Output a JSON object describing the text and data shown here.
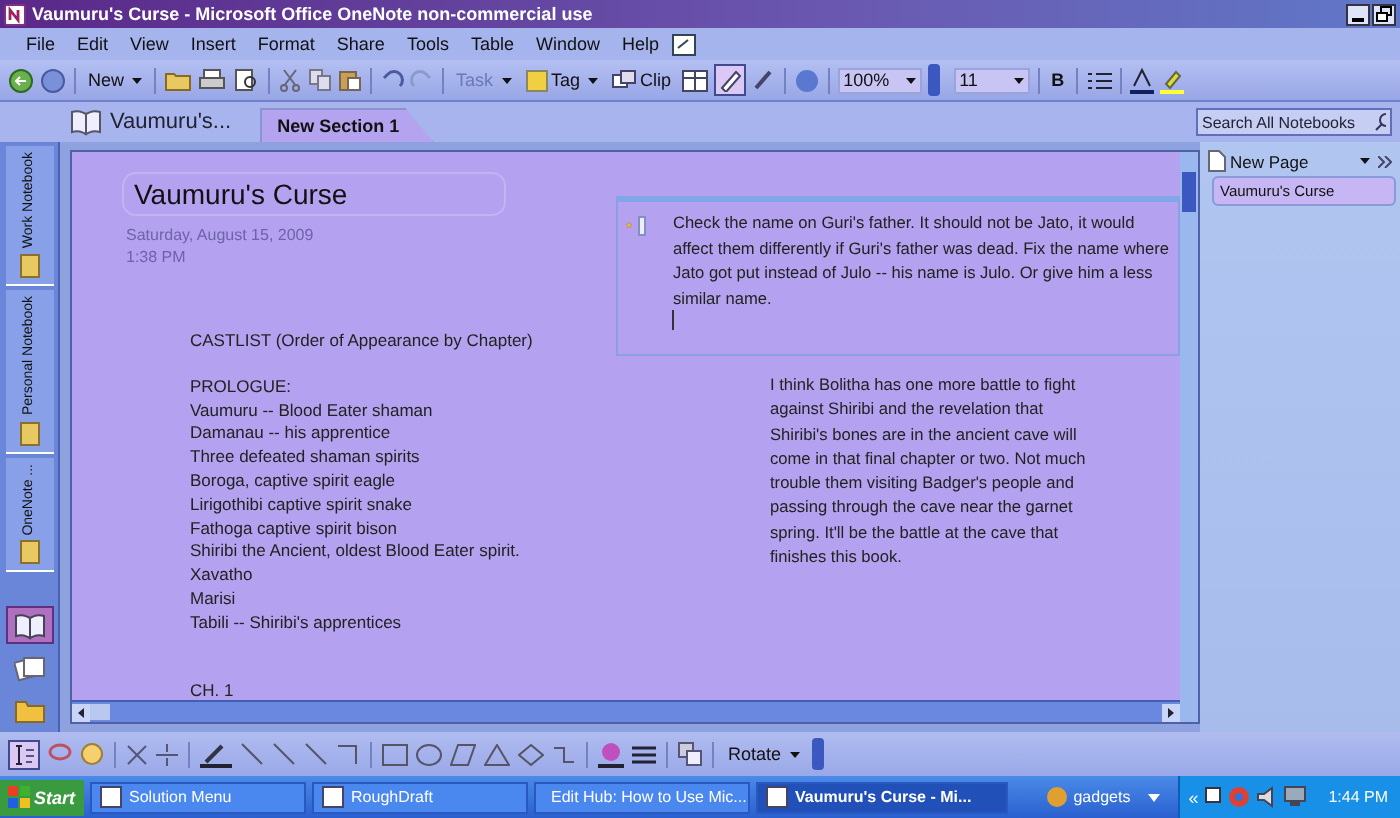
{
  "window": {
    "title": "Vaumuru's Curse - Microsoft Office OneNote non-commercial use"
  },
  "menu": [
    "File",
    "Edit",
    "View",
    "Insert",
    "Format",
    "Share",
    "Tools",
    "Table",
    "Window",
    "Help"
  ],
  "toolbar": {
    "new": "New",
    "task": {
      "label": "Task",
      "disabled": true
    },
    "tag": "Tag",
    "clip": "Clip",
    "zoom": "100%",
    "font_size": "11",
    "bold": "B"
  },
  "notebook": {
    "title": "Vaumuru's...",
    "sections": [
      {
        "label": "New Section 1",
        "selected": true
      }
    ]
  },
  "search": {
    "placeholder": "Search All Notebooks"
  },
  "notebooks": [
    {
      "label": "Work Notebook"
    },
    {
      "label": "Personal Notebook"
    },
    {
      "label": "OneNote ..."
    }
  ],
  "page": {
    "title": "Vaumuru's Curse",
    "date": "Saturday, August 15, 2009",
    "time": "1:38 PM",
    "note": "Check the name on Guri's father. It should not be Jato, it would affect them differently if Guri's father was dead. Fix the name where Jato got put instead of Julo -- his name is Julo. Or give him a less similar name.",
    "note_checked": false,
    "castlist_heading": "CASTLIST (Order of Appearance by Chapter)",
    "prologue": [
      "PROLOGUE:",
      "Vaumuru -- Blood Eater shaman",
      "Damanau -- his apprentice",
      "Three defeated shaman spirits",
      "Boroga, captive spirit eagle",
      "Lirigothibi captive spirit snake",
      "Fathoga captive spirit bison",
      "Shiribi the Ancient, oldest Blood Eater spirit.",
      "Xavatho",
      "Marisi",
      "Tabili -- Shiribi's apprentices"
    ],
    "chapter_heading": "CH. 1",
    "paragraph": "I think Bolitha has one more battle to fight against Shiribi and the revelation that Shiribi's bones are in the ancient cave will come in that final chapter or two. Not much trouble them visiting Badger's people and passing through the cave near the garnet spring. It'll be the battle at the cave that finishes this book."
  },
  "pages_pane": {
    "new_page": "New Page",
    "pages": [
      {
        "label": "Vaumuru's Curse",
        "selected": true
      }
    ]
  },
  "drawing_toolbar": {
    "rotate": "Rotate"
  },
  "taskbar": {
    "start": "Start",
    "tasks": [
      {
        "label": "Solution Menu",
        "selected": false
      },
      {
        "label": "RoughDraft",
        "selected": false
      },
      {
        "label": "Edit Hub: How to Use Mic...",
        "selected": false
      },
      {
        "label": "Vaumuru's Curse - Mi...",
        "selected": true
      }
    ],
    "gadgets": "gadgets",
    "tray_expand": "«",
    "clock": "1:44 PM"
  }
}
